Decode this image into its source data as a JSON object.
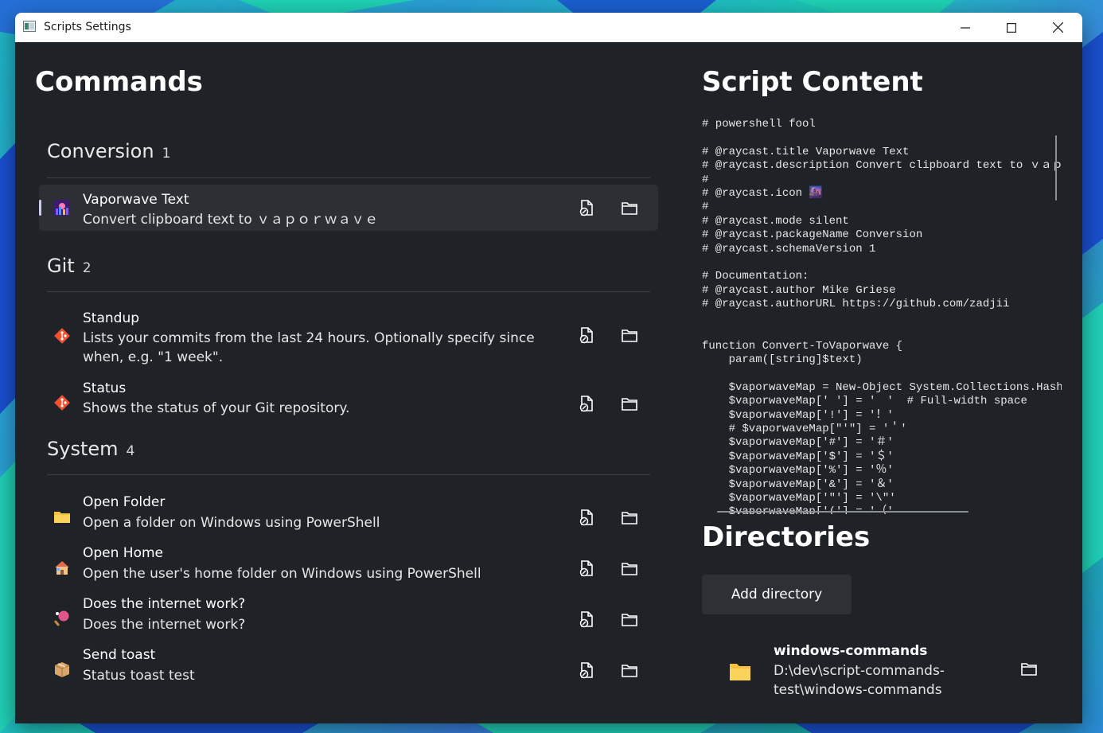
{
  "window": {
    "title": "Scripts Settings"
  },
  "left": {
    "heading": "Commands",
    "groups": [
      {
        "name": "Conversion",
        "count": "1",
        "items": [
          {
            "title": "Vaporwave Text",
            "description": "Convert clipboard text to ｖａｐｏｒｗａｖｅ",
            "icon": "vaporwave-icon"
          }
        ]
      },
      {
        "name": "Git",
        "count": "2",
        "items": [
          {
            "title": "Standup",
            "description": "Lists your commits from the last 24 hours. Optionally specify since when, e.g. \"1 week\".",
            "icon": "git-icon"
          },
          {
            "title": "Status",
            "description": "Shows the status of your Git repository.",
            "icon": "git-icon"
          }
        ]
      },
      {
        "name": "System",
        "count": "4",
        "items": [
          {
            "title": "Open Folder",
            "description": "Open a folder on Windows using PowerShell",
            "icon": "folder-icon"
          },
          {
            "title": "Open Home",
            "description": "Open the user's home folder on Windows using PowerShell",
            "icon": "house-icon"
          },
          {
            "title": "Does the internet work?",
            "description": "Does the internet work?",
            "icon": "ping-pong-icon"
          },
          {
            "title": "Send toast",
            "description": "Status toast test",
            "icon": "package-icon"
          }
        ]
      }
    ]
  },
  "script": {
    "heading": "Script Content",
    "code": "# powershell fool\n\n# @raycast.title Vaporwave Text\n# @raycast.description Convert clipboard text to ｖａｐｏｒｗａｖｅ\n#\n# @raycast.icon 🌆\n#\n# @raycast.mode silent\n# @raycast.packageName Conversion\n# @raycast.schemaVersion 1\n\n# Documentation:\n# @raycast.author Mike Griese\n# @raycast.authorURL https://github.com/zadjii\n\n\nfunction Convert-ToVaporwave {\n    param([string]$text)\n\n    $vaporwaveMap = New-Object System.Collections.Hashtable\n    $vaporwaveMap[' '] = '　'  # Full-width space\n    $vaporwaveMap['!'] = '！'\n    # $vaporwaveMap[\"'\"] = '＇'\n    $vaporwaveMap['#'] = '＃'\n    $vaporwaveMap['$'] = '＄'\n    $vaporwaveMap['%'] = '％'\n    $vaporwaveMap['&'] = '＆'\n    $vaporwaveMap['\"'] = '\\\"'\n    $vaporwaveMap['('] = '（'"
  },
  "directories": {
    "heading": "Directories",
    "add_label": "Add directory",
    "items": [
      {
        "name": "windows-commands",
        "path": "D:\\dev\\script-commands-test\\windows-commands"
      }
    ]
  },
  "colors": {
    "window_bg": "#1f2327",
    "selected_bg": "#2c3035",
    "accent_bar": "#c9c9ff",
    "git": "#f05133",
    "folder": "#f8c33c"
  }
}
